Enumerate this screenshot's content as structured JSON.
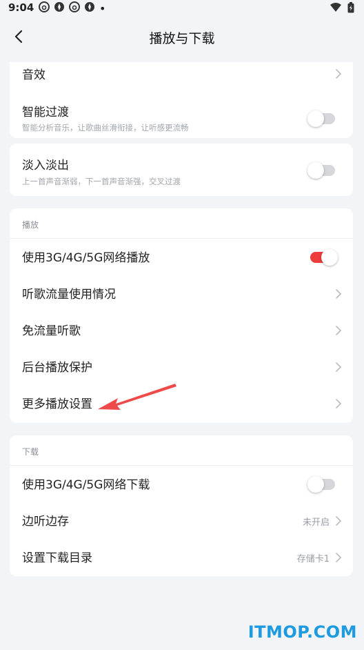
{
  "status_bar": {
    "time": "9:04",
    "left_icons": [
      "netease-music-icon",
      "app-icon",
      "netease-music-icon",
      "app-icon"
    ],
    "right_icons": [
      "wifi-icon",
      "battery-icon"
    ]
  },
  "nav": {
    "title": "播放与下载",
    "back_icon": "chevron-left-icon"
  },
  "effects_card": {
    "items": [
      {
        "label": "音效",
        "control": "chevron"
      },
      {
        "label": "智能过渡",
        "subtitle": "智能分析音乐，让歌曲丝滑衔接，让听感更流畅",
        "control": "toggle",
        "on": false
      }
    ]
  },
  "fade_card": {
    "items": [
      {
        "label": "淡入淡出",
        "subtitle": "上一首声音渐弱，下一首声音渐强，交叉过渡",
        "control": "toggle",
        "on": false
      }
    ]
  },
  "playback_section": {
    "title": "播放",
    "items": [
      {
        "label": "使用3G/4G/5G网络播放",
        "control": "toggle",
        "on": true
      },
      {
        "label": "听歌流量使用情况",
        "control": "chevron"
      },
      {
        "label": "免流量听歌",
        "control": "chevron"
      },
      {
        "label": "后台播放保护",
        "control": "chevron"
      },
      {
        "label": "更多播放设置",
        "control": "chevron"
      }
    ]
  },
  "download_section": {
    "title": "下载",
    "items": [
      {
        "label": "使用3G/4G/5G网络下载",
        "control": "toggle",
        "on": false
      },
      {
        "label": "边听边存",
        "value": "未开启",
        "control": "chevron"
      },
      {
        "label": "设置下载目录",
        "value": "存储卡1",
        "control": "chevron"
      }
    ]
  },
  "annotation": {
    "arrow_color": "#ef4a4a"
  },
  "colors": {
    "toggle_on": "#ee3b3b",
    "toggle_off": "#d5d7db",
    "background": "#f2f4f7"
  },
  "watermark": "ITMOP.COM"
}
